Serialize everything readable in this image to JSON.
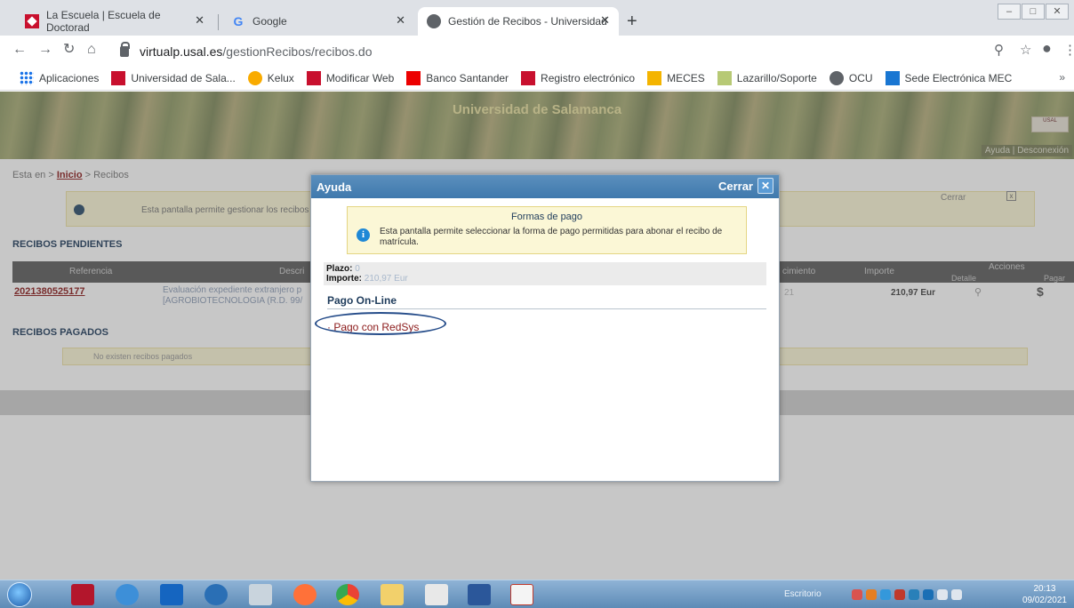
{
  "browser": {
    "tabs": [
      {
        "title": "La Escuela | Escuela de Doctorad",
        "icon": "usal-icon",
        "active": false
      },
      {
        "title": "Google",
        "icon": "google-icon",
        "active": false
      },
      {
        "title": "Gestión de Recibos - Universidad",
        "icon": "globe-icon",
        "active": true
      }
    ],
    "new_tab": "+",
    "url_host": "virtualp.usal.es",
    "url_path": "/gestionRecibos/recibos.do",
    "bookmarks": [
      {
        "label": "Aplicaciones",
        "icon": "apps-grid-icon"
      },
      {
        "label": "Universidad de Sala...",
        "icon": "usal-icon"
      },
      {
        "label": "Kelux",
        "icon": "kelux-icon"
      },
      {
        "label": "Modificar Web",
        "icon": "usal-icon"
      },
      {
        "label": "Banco Santander",
        "icon": "santander-icon"
      },
      {
        "label": "Registro electrónico",
        "icon": "usal-icon"
      },
      {
        "label": "MECES",
        "icon": "meces-icon"
      },
      {
        "label": "Lazarillo/Soporte",
        "icon": "lazarillo-icon"
      },
      {
        "label": "OCU",
        "icon": "globe-icon"
      },
      {
        "label": "Sede Electrónica MEC",
        "icon": "mec-icon"
      }
    ],
    "bookmarks_more": "»"
  },
  "page": {
    "banner_title": "Universidad de Salamanca",
    "banner_links": "Ayuda | Desconexión",
    "breadcrumb_prefix": "Esta en  > ",
    "breadcrumb_home": "Inicio",
    "breadcrumb_current": " > Recibos",
    "info_text": "Esta pantalla permite gestionar los recibos",
    "cerrar": "Cerrar",
    "pending_title": "RECIBOS PENDIENTES",
    "columns": {
      "referencia": "Referencia",
      "descripcion": "Descri",
      "vencimiento": "cimiento",
      "importe": "Importe",
      "acciones": "Acciones",
      "detalle": "Detalle",
      "pagar": "Pagar"
    },
    "row": {
      "referencia": "2021380525177",
      "descripcion_1": "Evaluación expediente extranjero p",
      "descripcion_2": "[AGROBIOTECNOLOGIA (R.D. 99/",
      "vencimiento": "21",
      "importe": "210,97 Eur",
      "pagar": "$"
    },
    "paid_title": "RECIBOS PAGADOS",
    "paid_empty": "No existen recibos pagados"
  },
  "modal": {
    "title": "Ayuda",
    "close_label": "Cerrar",
    "info_title": "Formas de pago",
    "info_text": "Esta pantalla permite seleccionar la forma de pago permitidas para abonar el recibo de matrícula.",
    "plazo_label": "Plazo:",
    "plazo_value": "0",
    "importe_label": "Importe:",
    "importe_value": "210,97 Eur",
    "section_title": "Pago On-Line",
    "pay_option": "· Pago con RedSys"
  },
  "taskbar": {
    "desktop_label": "Escritorio",
    "time": "20:13",
    "date": "09/02/2021"
  },
  "colors": {
    "modal_header": "#3f79ad",
    "link_red": "#8b1a1a",
    "info_yellow": "#fbf7d6",
    "highlight_ellipse": "#264d8a"
  }
}
